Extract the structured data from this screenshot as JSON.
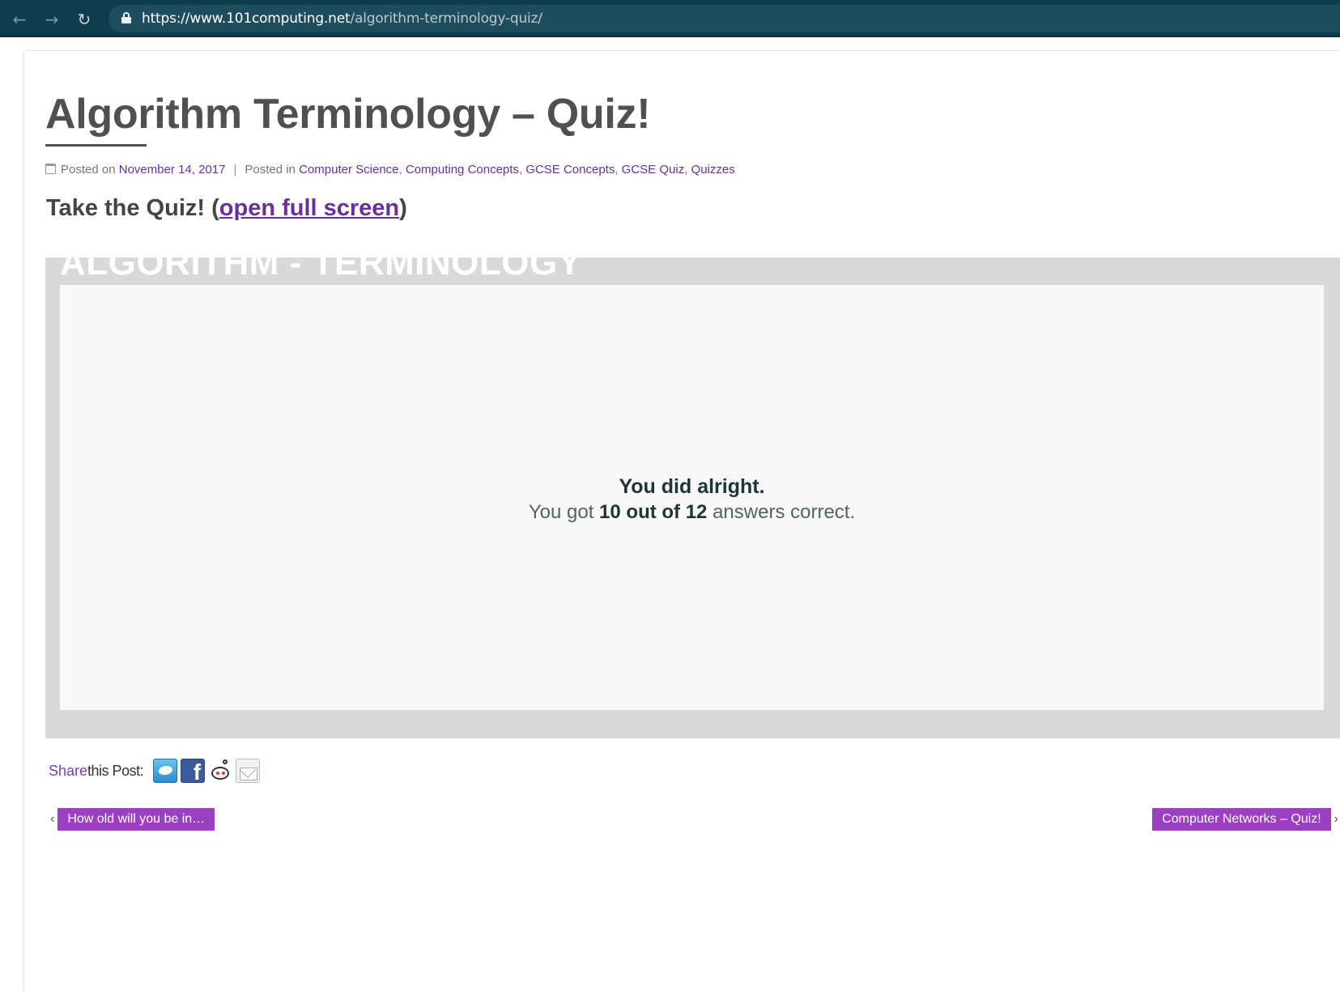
{
  "browser": {
    "url_host": "https://www.101computing.net",
    "url_path": "/algorithm-terminology-quiz/"
  },
  "post": {
    "title": "Algorithm Terminology – Quiz!",
    "meta": {
      "posted_on_label": "Posted on",
      "date": "November 14, 2017",
      "separator": "|",
      "posted_in_label": "Posted in",
      "categories": [
        "Computer Science",
        "Computing Concepts",
        "GCSE Concepts",
        "GCSE Quiz",
        "Quizzes"
      ]
    },
    "quiz_heading": {
      "prefix": "Take the Quiz! (",
      "link": "open full screen",
      "suffix": ")"
    }
  },
  "quiz": {
    "banner": "ALGORITHM - TERMINOLOGY",
    "verdict": "You did alright.",
    "score_prefix": "You got",
    "score_value": "10 out of 12",
    "score_suffix": "answers correct."
  },
  "share": {
    "word": "Share",
    "rest": "this Post:",
    "icons": [
      "twitter-icon",
      "facebook-icon",
      "reddit-icon",
      "email-icon"
    ]
  },
  "navigation": {
    "prev_arrow": "‹",
    "prev_label": "How old will you be in…",
    "next_label": "Computer Networks – Quiz!",
    "next_arrow": "›"
  },
  "colors": {
    "chrome": "#0f3d4e",
    "link": "#6a2f9a",
    "nav_button": "#9c3fc2",
    "quiz_frame": "#d9d9d9"
  }
}
